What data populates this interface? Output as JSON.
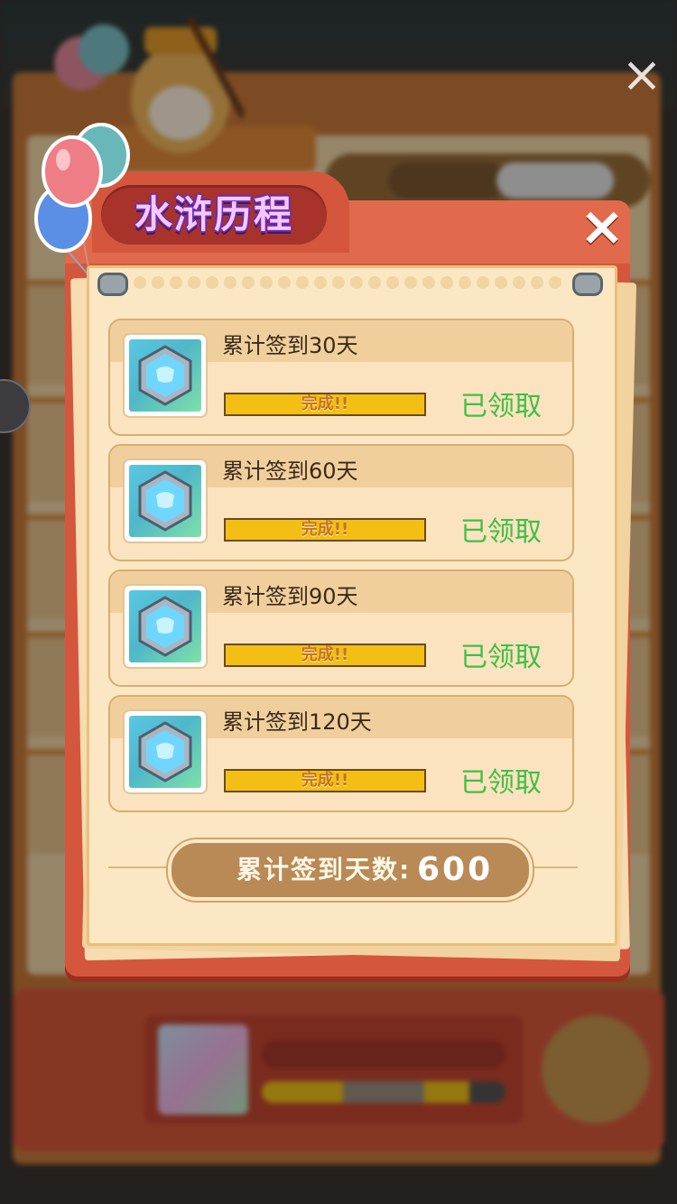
{
  "dialog": {
    "title": "水浒历程",
    "close_symbol": "×",
    "items": [
      {
        "title": "累计签到30天",
        "progress_text": "完成!!",
        "progress": 1.0,
        "status": "已领取",
        "reward_icon": "hexagon-gem-icon"
      },
      {
        "title": "累计签到60天",
        "progress_text": "完成!!",
        "progress": 1.0,
        "status": "已领取",
        "reward_icon": "hexagon-gem-icon"
      },
      {
        "title": "累计签到90天",
        "progress_text": "完成!!",
        "progress": 1.0,
        "status": "已领取",
        "reward_icon": "hexagon-gem-icon"
      },
      {
        "title": "累计签到120天",
        "progress_text": "完成!!",
        "progress": 1.0,
        "status": "已领取",
        "reward_icon": "hexagon-gem-icon"
      }
    ],
    "total_label": "累计签到天数:",
    "total_value": "600"
  },
  "background": {
    "close_symbol": "×"
  },
  "colors": {
    "dialog_red": "#d4563d",
    "paper": "#fbe7c4",
    "progress_fill": "#f4bf14",
    "claimed_green": "#3fbf45",
    "title_purple": "#f7c8ff"
  }
}
